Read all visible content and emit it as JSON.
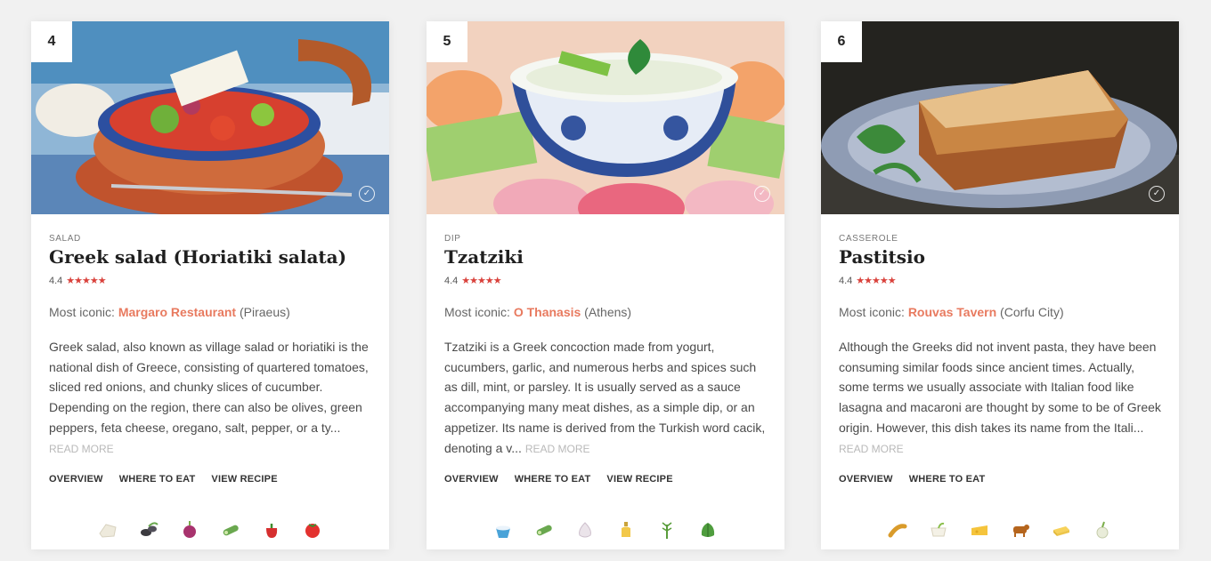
{
  "cards": [
    {
      "rank": "4",
      "category": "SALAD",
      "title": "Greek salad (Horiatiki salata)",
      "rating": "4.4",
      "stars": "★★★★★",
      "iconic_prefix": "Most iconic: ",
      "restaurant": "Margaro Restaurant",
      "location": " (Piraeus)",
      "description": "Greek salad, also known as village salad or horiatiki is the national dish of Greece, consisting of quartered tomatoes, sliced red onions, and chunky slices of cucumber. Depending on the region, there can also be olives, green peppers, feta cheese, oregano, salt, pepper, or a ty... ",
      "read_more": "READ MORE",
      "links": [
        "OVERVIEW",
        "WHERE TO EAT",
        "VIEW RECIPE"
      ],
      "ingredients": [
        "feta-icon",
        "olive-icon",
        "red-onion-icon",
        "cucumber-icon",
        "pepper-icon",
        "tomato-icon"
      ]
    },
    {
      "rank": "5",
      "category": "DIP",
      "title": "Tzatziki",
      "rating": "4.4",
      "stars": "★★★★★",
      "iconic_prefix": "Most iconic: ",
      "restaurant": "O Thanasis",
      "location": " (Athens)",
      "description": "Tzatziki is a Greek concoction made from yogurt, cucumbers, garlic, and numerous herbs and spices such as dill, mint, or parsley. It is usually served as a sauce accompanying many meat dishes, as a simple dip, or an appetizer. Its name is derived from the Turkish word cacik, denoting a v... ",
      "read_more": "READ MORE",
      "links": [
        "OVERVIEW",
        "WHERE TO EAT",
        "VIEW RECIPE"
      ],
      "ingredients": [
        "yogurt-icon",
        "cucumber-icon",
        "garlic-icon",
        "olive-oil-icon",
        "dill-icon",
        "mint-icon"
      ]
    },
    {
      "rank": "6",
      "category": "CASSEROLE",
      "title": "Pastitsio",
      "rating": "4.4",
      "stars": "★★★★★",
      "iconic_prefix": "Most iconic: ",
      "restaurant": "Rouvas Tavern",
      "location": " (Corfu City)",
      "description": "Although the Greeks did not invent pasta, they have been consuming similar foods since ancient times. Actually, some terms we usually associate with Italian food like lasagna and macaroni are thought by some to be of Greek origin. However, this dish takes its name from the Itali... ",
      "read_more": "READ MORE",
      "links": [
        "OVERVIEW",
        "WHERE TO EAT"
      ],
      "ingredients": [
        "pasta-icon",
        "bechamel-icon",
        "cheese-icon",
        "beef-icon",
        "butter-icon",
        "onion-icon"
      ]
    }
  ],
  "colors": {
    "accent": "#e87a5f",
    "stars": "#d9413b",
    "read_more": "#b9b9b9"
  }
}
